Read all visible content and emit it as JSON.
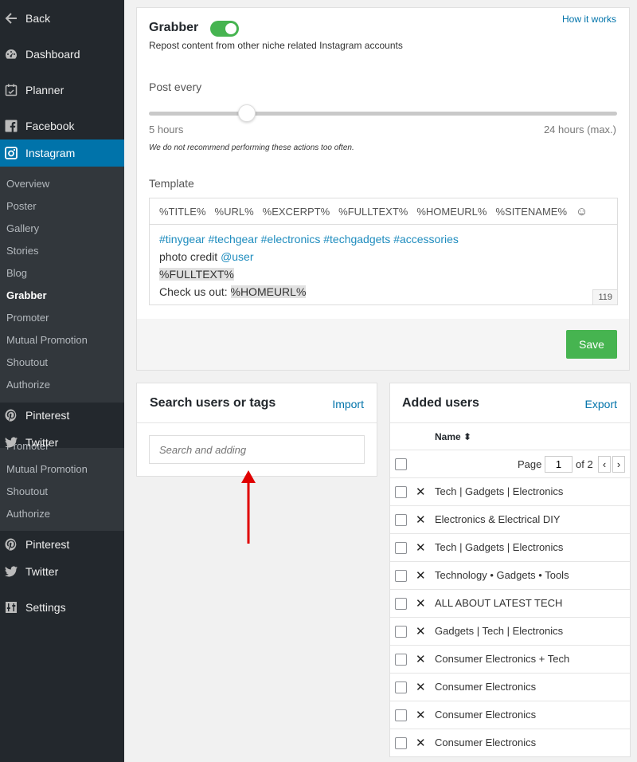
{
  "sidebar": {
    "back": "Back",
    "dashboard": "Dashboard",
    "planner": "Planner",
    "facebook": "Facebook",
    "instagram": "Instagram",
    "instagram_sub": [
      "Overview",
      "Poster",
      "Gallery",
      "Stories",
      "Blog",
      "Grabber",
      "Promoter",
      "Mutual Promotion",
      "Shoutout",
      "Authorize"
    ],
    "pinterest": "Pinterest",
    "twitter": "Twitter",
    "ghost_sub": [
      "Promoter",
      "Mutual Promotion",
      "Shoutout",
      "Authorize"
    ],
    "pinterest2": "Pinterest",
    "twitter2": "Twitter",
    "settings": "Settings"
  },
  "grabber": {
    "title": "Grabber",
    "subtitle": "Repost content from other niche related Instagram accounts",
    "how_it_works": "How it works",
    "enabled": true,
    "post_every_label": "Post every",
    "slider_min": "5 hours",
    "slider_max": "24 hours (max.)",
    "slider_value_fraction": 0.21,
    "note": "We do not recommend performing these actions too often.",
    "template_label": "Template",
    "vars": [
      "%TITLE%",
      "%URL%",
      "%EXCERPT%",
      "%FULLTEXT%",
      "%HOMEURL%",
      "%SITENAME%",
      "☺"
    ],
    "tags_line": "#tinygear #techgear #electronics #techgadgets #accessories",
    "credit_text": "photo credit ",
    "credit_user": "@user",
    "fulltext": "%FULLTEXT%",
    "checkout_text": "Check us out: ",
    "homeurl": "%HOMEURL%",
    "counter": "119",
    "save": "Save"
  },
  "search": {
    "title": "Search users or tags",
    "import": "Import",
    "placeholder": "Search and adding"
  },
  "added_users": {
    "title": "Added users",
    "export": "Export",
    "name_col": "Name ⬍",
    "page_label": "Page",
    "page_value": "1",
    "of_label": "of 2",
    "prev": "‹",
    "next": "›",
    "users": [
      "Tech | Gadgets | Electronics",
      "Electronics & Electrical DIY",
      "Tech | Gadgets | Electronics",
      "Technology • Gadgets • Tools",
      "ALL ABOUT LATEST TECH",
      "Gadgets | Tech | Electronics",
      "Consumer Electronics + Tech",
      "Consumer Electronics",
      "Consumer Electronics",
      "Consumer Electronics"
    ]
  },
  "colors": {
    "sidebar_bg": "#23282d",
    "active": "#0073aa",
    "green": "#46b450",
    "link": "#0073aa",
    "arrow": "#e00000"
  }
}
